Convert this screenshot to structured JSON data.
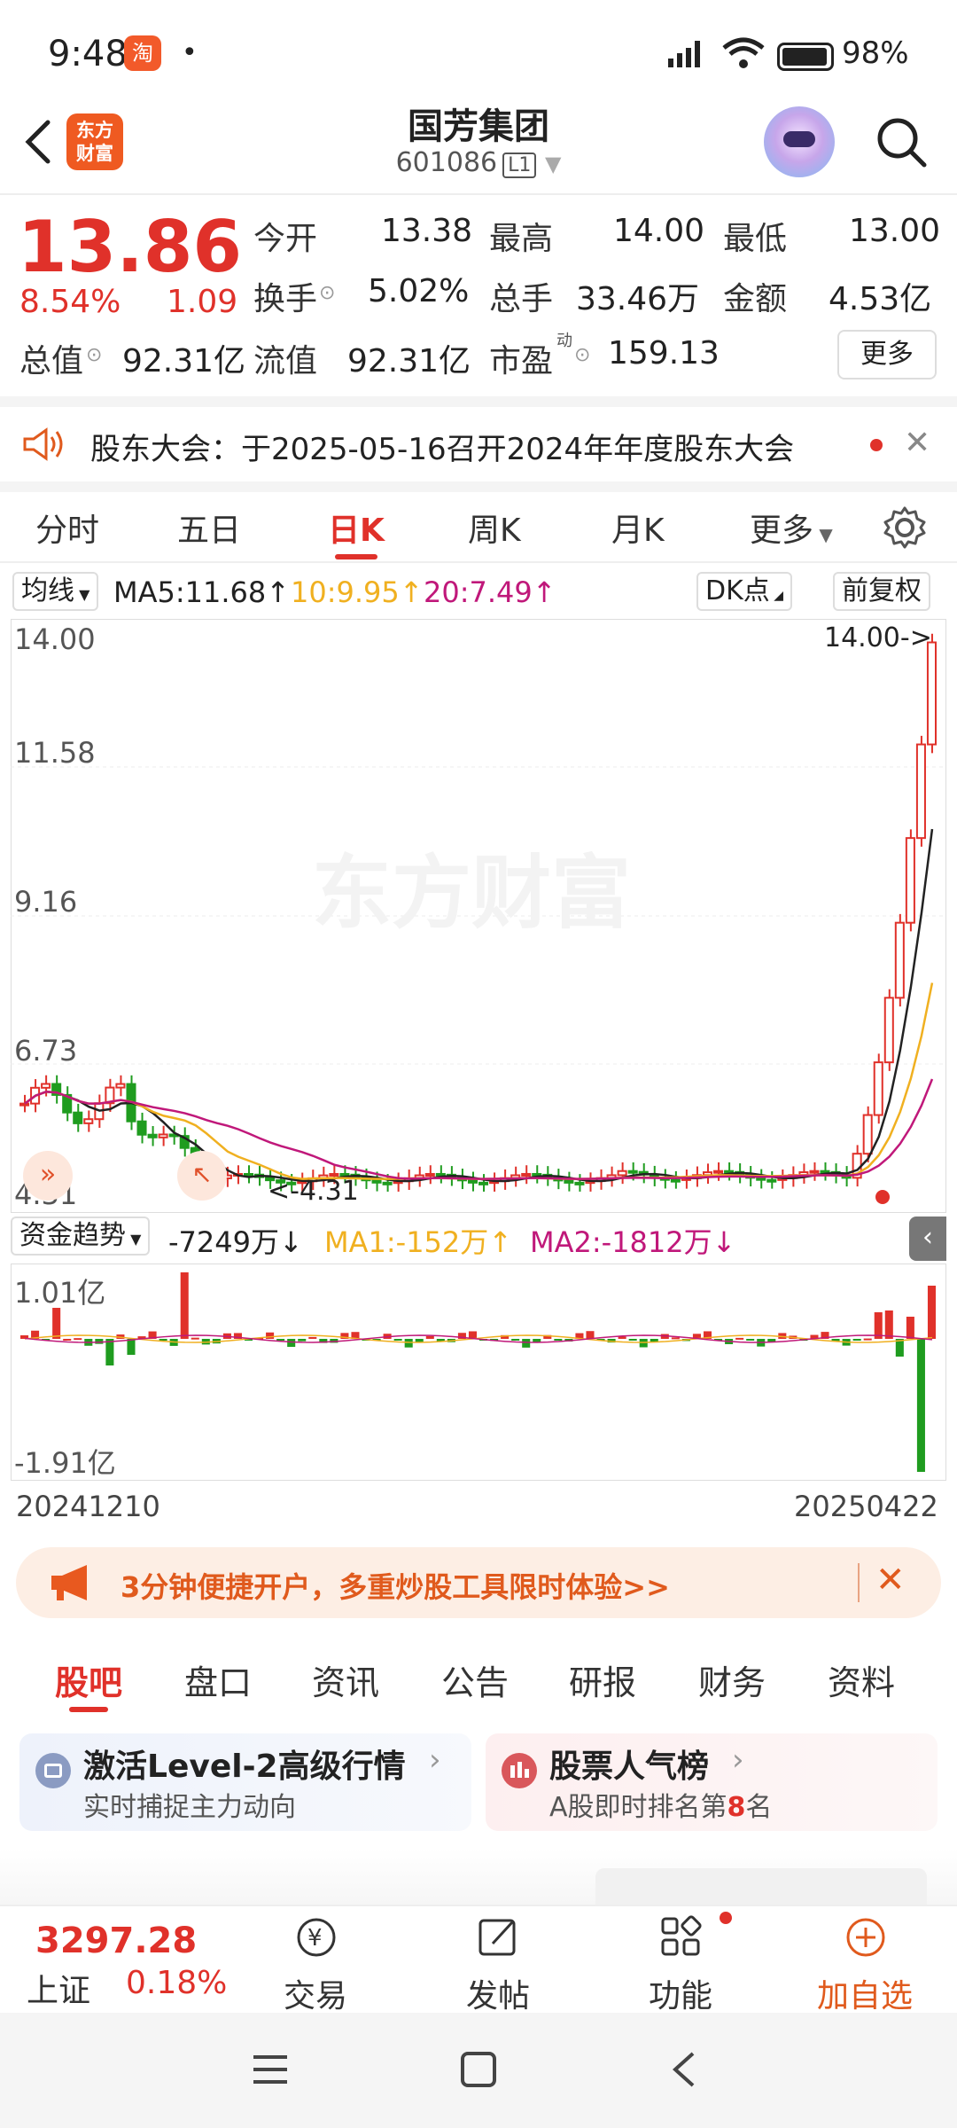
{
  "status": {
    "time": "9:48",
    "app_badge": "淘",
    "battery": "98%"
  },
  "header": {
    "name": "国芳集团",
    "code": "601086",
    "level": "L1",
    "logo_line1": "东方",
    "logo_line2": "财富"
  },
  "quote": {
    "price": "13.86",
    "change_pct": "8.54%",
    "change": "1.09",
    "open_label": "今开",
    "open": "13.38",
    "high_label": "最高",
    "high": "14.00",
    "low_label": "最低",
    "low": "13.00",
    "turnover_label": "换手",
    "turnover": "5.02%",
    "volume_label": "总手",
    "volume": "33.46万",
    "amount_label": "金额",
    "amount": "4.53亿",
    "total_cap_label": "总值",
    "total_cap": "92.31亿",
    "float_cap_label": "流值",
    "float_cap": "92.31亿",
    "pe_label": "市盈",
    "pe_sup": "动",
    "pe": "159.13",
    "more": "更多"
  },
  "notice": {
    "text": "股东大会：于2025-05-16召开2024年年度股东大会"
  },
  "ktabs": [
    "分时",
    "五日",
    "日K",
    "周K",
    "月K",
    "更多"
  ],
  "ma": {
    "selector": "均线",
    "ma5": "MA5:11.68",
    "ma10": "10:9.95",
    "ma20": "20:7.49",
    "dk": "DK点",
    "fq": "前复权",
    "colors": {
      "ma5": "#222222",
      "ma10": "#f0b020",
      "ma20": "#c0187a",
      "up": "#e0312a",
      "down": "#1f9c1f"
    }
  },
  "chart": {
    "ylabels": [
      "14.00",
      "11.58",
      "9.16",
      "6.73",
      "4.31"
    ],
    "max_tag": "14.00->",
    "min_tag": "<-4.31",
    "watermark": "东方财富"
  },
  "flow": {
    "selector": "资金趋势",
    "value": "-7249万",
    "ma1": "MA1:-152万",
    "ma2": "MA2:-1812万",
    "top": "1.01亿",
    "bottom": "-1.91亿"
  },
  "dates": {
    "start": "20241210",
    "end": "20250422"
  },
  "promo": {
    "text": "3分钟便捷开户，多重炒股工具限时体验>>"
  },
  "btabs": [
    "股吧",
    "盘口",
    "资讯",
    "公告",
    "研报",
    "财务",
    "资料"
  ],
  "cards": [
    {
      "title": "激活Level-2高级行情",
      "sub": "实时捕捉主力动向"
    },
    {
      "title": "股票人气榜",
      "sub_pre": "A股即时排名第",
      "rank": "8",
      "sub_post": "名"
    }
  ],
  "bnav": {
    "index_value": "3297.28",
    "index_name": "上证",
    "index_pct": "0.18%",
    "trade": "交易",
    "post": "发帖",
    "func": "功能",
    "add": "加自选"
  }
}
